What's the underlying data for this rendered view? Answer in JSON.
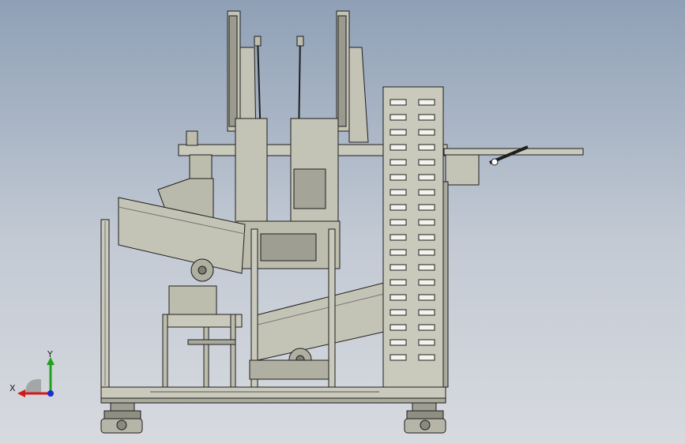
{
  "triad": {
    "x_label": "X",
    "y_label": "Y",
    "x_color": "#d11b1b",
    "y_color": "#1fa31f",
    "z_color": "#1b2fd1"
  },
  "colors": {
    "metal": "#bdbdae",
    "metal_dark": "#8e8e82",
    "edge": "#1e1e1e",
    "frame": "#c9c9bc"
  }
}
